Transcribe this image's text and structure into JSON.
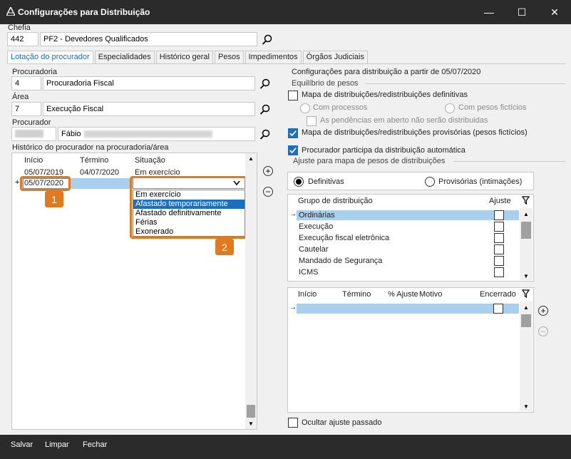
{
  "window": {
    "title": "Configurações para Distribuição"
  },
  "chefia": {
    "label": "Chefia",
    "code": "442",
    "name": "PF2 - Devedores Qualificados"
  },
  "tabs": [
    {
      "label": "Lotação do procurador"
    },
    {
      "label": "Especialidades"
    },
    {
      "label": "Histórico geral"
    },
    {
      "label": "Pesos"
    },
    {
      "label": "Impedimentos"
    },
    {
      "label": "Órgãos Judiciais"
    }
  ],
  "procuradoria": {
    "label": "Procuradoria",
    "code": "4",
    "name": "Procuradoria Fiscal"
  },
  "area": {
    "label": "Área",
    "code": "7",
    "name": "Execução Fiscal"
  },
  "procurador": {
    "label": "Procurador",
    "name": "Fábio"
  },
  "historico": {
    "label": "Histórico do procurador na procuradoria/área",
    "columns": [
      "Início",
      "Término",
      "Situação"
    ],
    "rows": [
      {
        "inicio": "05/07/2019",
        "termino": "04/07/2020",
        "situacao": "Em exercício"
      },
      {
        "inicio": "05/07/2020",
        "termino": "",
        "situacao": ""
      }
    ],
    "dropdown_options": [
      "Em exercício",
      "Afastado temporariamente",
      "Afastado definitivamente",
      "Férias",
      "Exonerado"
    ]
  },
  "badges": {
    "b1": "1",
    "b2": "2"
  },
  "config": {
    "title": "Configurações para distribuição a partir de 05/07/2020",
    "equilibrio_label": "Equilíbrio de pesos",
    "mapa_definitivas": "Mapa de distribuições/redistribuições definitivas",
    "com_processos": "Com processos",
    "com_pesos_ficticios": "Com pesos fictícios",
    "pendencias": "As pendências em aberto não serão distribuidas",
    "mapa_provisorias": "Mapa de distribuições/redistribuições provisórias (pesos fictícios)",
    "participa": "Procurador participa da distribuição automática",
    "ajuste_label": "Ajuste para mapa de pesos de distribuições",
    "radio_definitivas": "Definitivas",
    "radio_provisorias": "Provisórias (intimações)",
    "grupo_columns": [
      "Grupo de distribuição",
      "Ajuste"
    ],
    "grupos": [
      "Ordinárias",
      "Execução",
      "Execução fiscal eletrônica",
      "Cautelar",
      "Mandado de Segurança",
      "ICMS"
    ],
    "ajuste_columns": [
      "Início",
      "Término",
      "% Ajuste",
      "Motivo",
      "Encerrado"
    ],
    "ocultar": "Ocultar ajuste passado"
  },
  "footer": {
    "salvar": "Salvar",
    "limpar": "Limpar",
    "fechar": "Fechar"
  },
  "colors": {
    "accent": "#1a6fbf",
    "highlight": "#e07a1f",
    "title_bar": "#2b2b2b"
  }
}
